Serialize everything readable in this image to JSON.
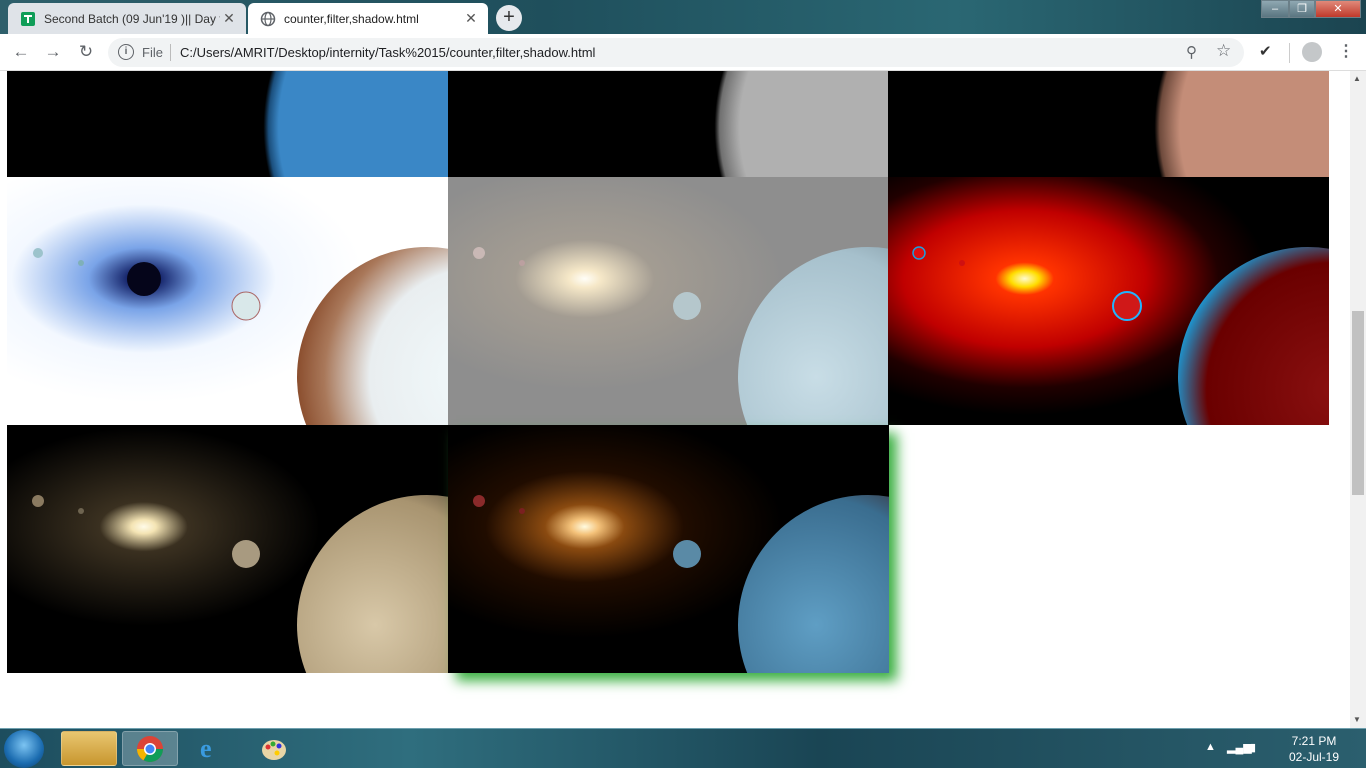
{
  "browser": {
    "tabs": [
      {
        "title": "Second Batch (09 Jun'19 )|| Day t",
        "favicon": "google-sheets-icon",
        "active": false
      },
      {
        "title": "counter,filter,shadow.html",
        "favicon": "globe-icon",
        "active": true
      }
    ],
    "close_glyph": "✕",
    "new_tab_glyph": "+",
    "address": {
      "scheme_label": "File",
      "url": "C:/Users/AMRIT/Desktop/internity/Task%2015/counter,filter,shadow.html"
    }
  },
  "page": {
    "images": [
      {
        "filter": "none",
        "name": "planet-image-original"
      },
      {
        "filter": "grayscale",
        "name": "planet-image-grayscale"
      },
      {
        "filter": "sepia-hue",
        "name": "planet-image-hue"
      },
      {
        "filter": "invert",
        "name": "planet-image-invert"
      },
      {
        "filter": "opacity-gray",
        "name": "planet-image-opacity"
      },
      {
        "filter": "saturate-red",
        "name": "planet-image-saturate"
      },
      {
        "filter": "sepia",
        "name": "planet-image-sepia"
      },
      {
        "filter": "drop-shadow",
        "name": "planet-image-shadow"
      }
    ],
    "shadow_color": "#3cb043"
  },
  "taskbar": {
    "time": "7:21 PM",
    "date": "02-Jul-19",
    "apps": [
      "explorer-icon",
      "chrome-icon",
      "ie-icon",
      "paint-icon"
    ]
  }
}
